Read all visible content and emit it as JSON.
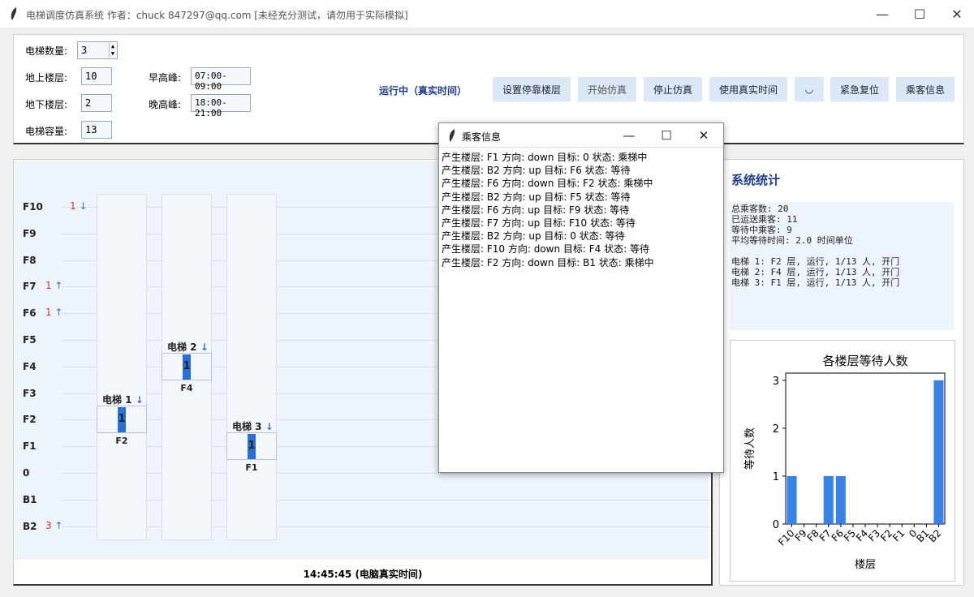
{
  "window": {
    "title": "电梯调度仿真系统 作者：chuck 847297@qq.com [未经充分测试，请勿用于实际模拟]",
    "minimize": "—",
    "maximize": "☐",
    "close": "✕"
  },
  "controls": {
    "elevator_count_label": "电梯数量:",
    "elevator_count_value": "3",
    "above_floors_label": "地上楼层:",
    "above_floors_value": "10",
    "below_floors_label": "地下楼层:",
    "below_floors_value": "2",
    "capacity_label": "电梯容量:",
    "capacity_value": "13",
    "morning_peak_label": "早高峰:",
    "morning_peak_value": "07:00-09:00",
    "evening_peak_label": "晚高峰:",
    "evening_peak_value": "18:00-21:00",
    "status": "运行中（真实时间）",
    "buttons": [
      "设置停靠楼层",
      "开始仿真",
      "停止仿真",
      "使用真实时间",
      "◡",
      "紧急复位",
      "乘客信息"
    ]
  },
  "simulation": {
    "floors": [
      "F10",
      "F9",
      "F8",
      "F7",
      "F6",
      "F5",
      "F4",
      "F3",
      "F2",
      "F1",
      "0",
      "B1",
      "B2"
    ],
    "waiting": [
      {
        "floor": "F10",
        "count": "1",
        "arrow": "↓"
      },
      {
        "floor": "F7",
        "count": "1",
        "arrow": "↑"
      },
      {
        "floor": "F6",
        "count": "1",
        "arrow": "↑"
      },
      {
        "floor": "B2",
        "count": "3",
        "arrow": "↑"
      }
    ],
    "elevators": [
      {
        "name": "电梯 1",
        "arrow": "↓",
        "load": "1",
        "floor": "F2"
      },
      {
        "name": "电梯 2",
        "arrow": "↓",
        "load": "1",
        "floor": "F4"
      },
      {
        "name": "电梯 3",
        "arrow": "↓",
        "load": "1",
        "floor": "F1"
      }
    ],
    "clock": "14:45:45 (电脑真实时间)"
  },
  "stats": {
    "title": "系统统计",
    "text": "总乘客数: 20\n已运送乘客: 11\n等待中乘客: 9\n平均等待时间: 2.0 时间单位\n\n电梯 1: F2 层, 运行, 1/13 人, 开门\n电梯 2: F4 层, 运行, 1/13 人, 开门\n电梯 3: F1 层, 运行, 1/13 人, 开门"
  },
  "chart_data": {
    "type": "bar",
    "title": "各楼层等待人数",
    "xlabel": "楼层",
    "ylabel": "等待人数",
    "categories": [
      "F10",
      "F9",
      "F8",
      "F7",
      "F6",
      "F5",
      "F4",
      "F3",
      "F2",
      "F1",
      "0",
      "B1",
      "B2"
    ],
    "values": [
      1,
      0,
      0,
      1,
      1,
      0,
      0,
      0,
      0,
      0,
      0,
      0,
      3
    ],
    "yticks": [
      "0",
      "1",
      "2",
      "3"
    ],
    "ylim": [
      0,
      3.15
    ],
    "color": "#3b82e6"
  },
  "popup": {
    "title": "乘客信息",
    "minimize": "—",
    "maximize": "☐",
    "close": "✕",
    "lines": [
      "产生楼层: F1  方向: down  目标: 0  状态: 乘梯中",
      "产生楼层: B2  方向: up  目标: F6  状态: 等待",
      "产生楼层: F6  方向: down  目标: F2  状态: 乘梯中",
      "产生楼层: B2  方向: up  目标: F5  状态: 等待",
      "产生楼层: F6  方向: up  目标: F9  状态: 等待",
      "产生楼层: F7  方向: up  目标: F10  状态: 等待",
      "产生楼层: B2  方向: up  目标: 0  状态: 等待",
      "产生楼层: F10  方向: down  目标: F4  状态: 等待",
      "产生楼层: F2  方向: down  目标: B1  状态: 乘梯中"
    ]
  }
}
